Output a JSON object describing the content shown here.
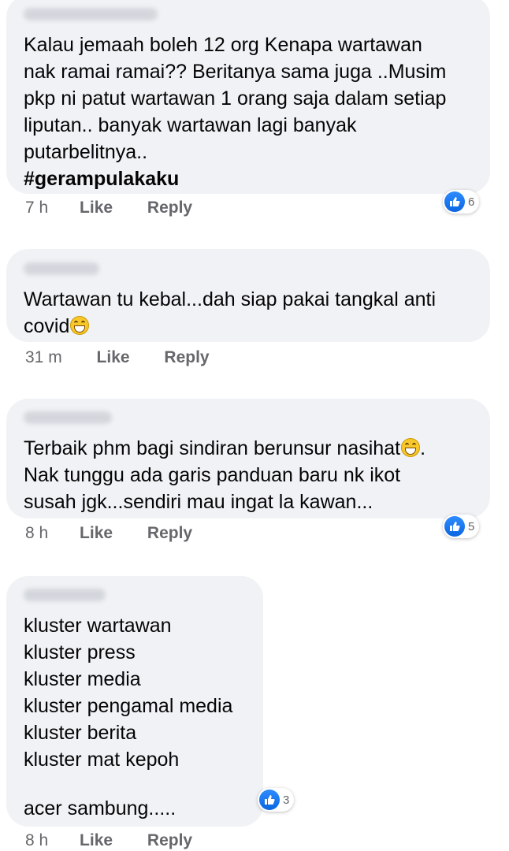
{
  "comments": [
    {
      "lines": [
        "Kalau jemaah boleh 12 org Kenapa wartawan",
        "nak ramai ramai?? Beritanya sama juga ..Musim",
        "pkp ni patut wartawan 1 orang saja dalam setiap",
        "liputan.. banyak wartawan lagi banyak",
        "putarbelitnya.."
      ],
      "hashtag": "#gerampulakaku",
      "time": "7 h",
      "like_label": "Like",
      "reply_label": "Reply",
      "reaction_count": "6",
      "reaction_icon": "like-thumb-icon"
    },
    {
      "line1": "Wartawan tu kebal...dah siap pakai tangkal anti",
      "line2": "covid",
      "emoji": "grinning-face-icon",
      "time": "31 m",
      "like_label": "Like",
      "reply_label": "Reply"
    },
    {
      "line1_text": "Terbaik phm bagi sindiran berunsur nasihat",
      "line1_end": ".",
      "emoji": "laughing-face-icon",
      "line2": "Nak tunggu ada garis panduan baru nk ikot",
      "line3": "susah jgk...sendiri mau ingat la kawan...",
      "time": "8 h",
      "like_label": "Like",
      "reply_label": "Reply",
      "reaction_count": "5",
      "reaction_icon": "like-thumb-icon"
    },
    {
      "lines": [
        "kluster wartawan",
        "kluster press",
        "kluster media",
        "kluster pengamal media",
        "kluster berita",
        "kluster mat kepoh"
      ],
      "closing": "acer sambung.....",
      "time": "8 h",
      "like_label": "Like",
      "reply_label": "Reply",
      "reaction_count": "3",
      "reaction_icon": "like-thumb-icon"
    }
  ],
  "colors": {
    "bubble": "#f0f2f5",
    "meta_text": "#65676b",
    "like_blue": "#1877f2"
  }
}
